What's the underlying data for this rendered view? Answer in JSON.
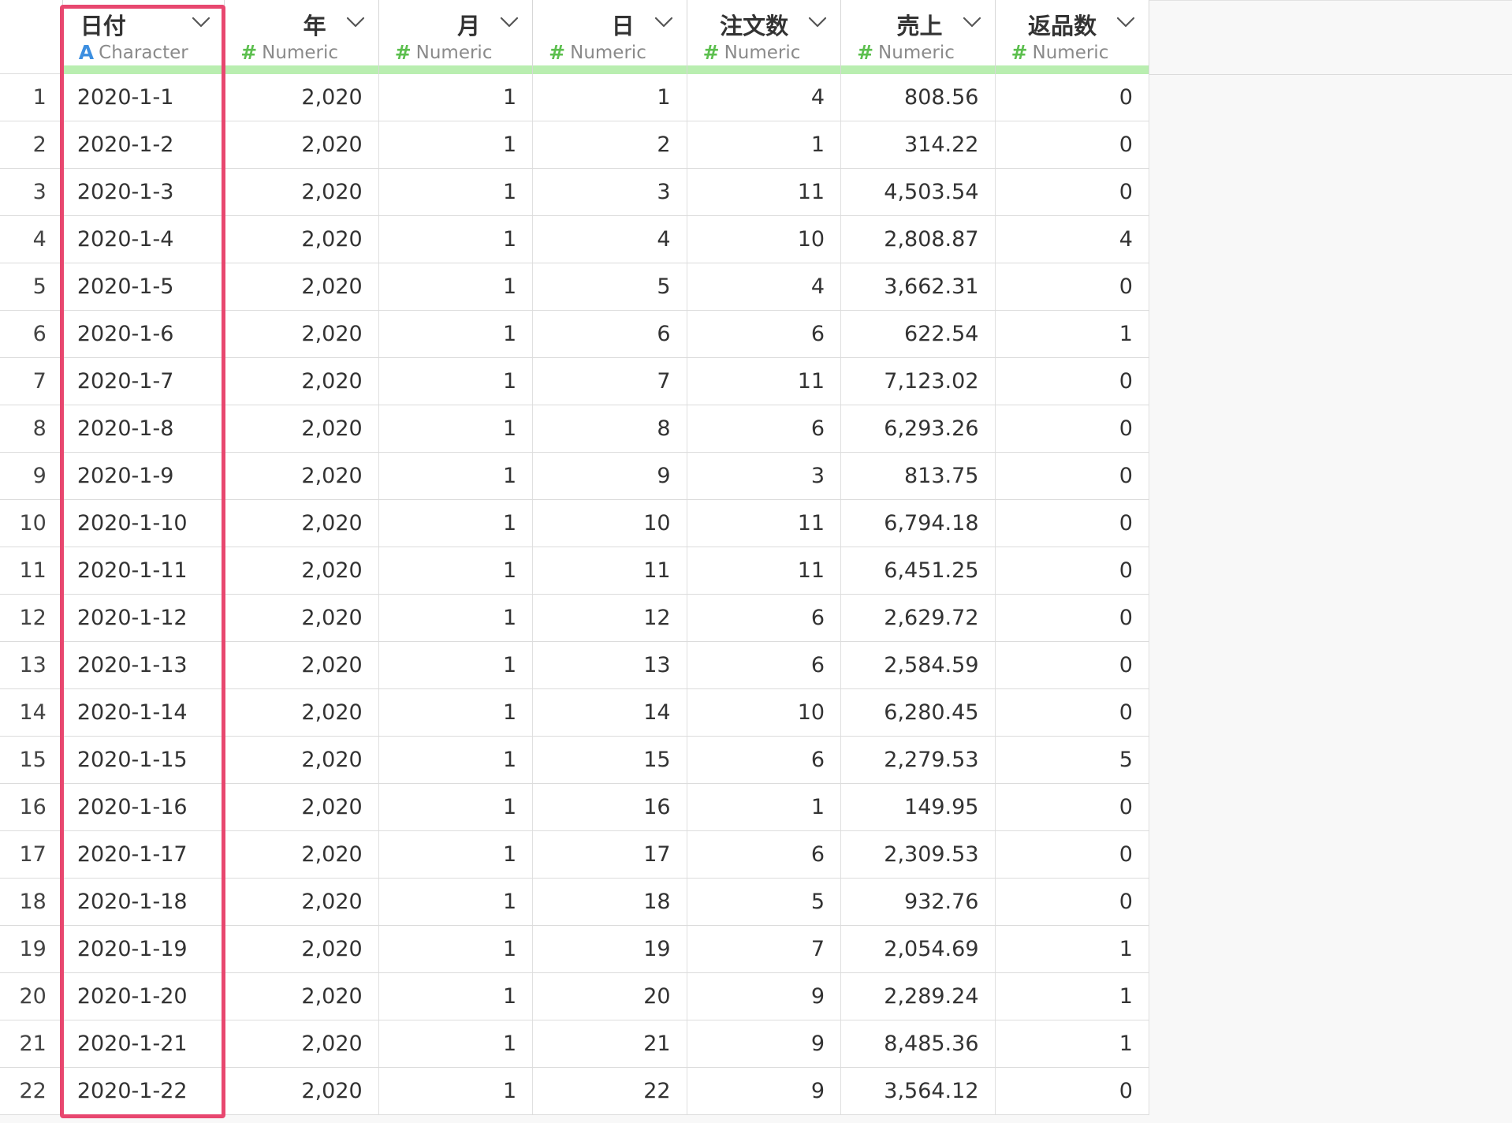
{
  "columns": [
    {
      "name": "日付",
      "type_icon": "A",
      "type_label": "Character",
      "kind": "character"
    },
    {
      "name": "年",
      "type_icon": "#",
      "type_label": "Numeric",
      "kind": "numeric"
    },
    {
      "name": "月",
      "type_icon": "#",
      "type_label": "Numeric",
      "kind": "numeric"
    },
    {
      "name": "日",
      "type_icon": "#",
      "type_label": "Numeric",
      "kind": "numeric"
    },
    {
      "name": "注文数",
      "type_icon": "#",
      "type_label": "Numeric",
      "kind": "numeric"
    },
    {
      "name": "売上",
      "type_icon": "#",
      "type_label": "Numeric",
      "kind": "numeric"
    },
    {
      "name": "返品数",
      "type_icon": "#",
      "type_label": "Numeric",
      "kind": "numeric"
    }
  ],
  "rows": [
    {
      "index": "1",
      "cells": [
        "2020-1-1",
        "2,020",
        "1",
        "1",
        "4",
        "808.56",
        "0"
      ]
    },
    {
      "index": "2",
      "cells": [
        "2020-1-2",
        "2,020",
        "1",
        "2",
        "1",
        "314.22",
        "0"
      ]
    },
    {
      "index": "3",
      "cells": [
        "2020-1-3",
        "2,020",
        "1",
        "3",
        "11",
        "4,503.54",
        "0"
      ]
    },
    {
      "index": "4",
      "cells": [
        "2020-1-4",
        "2,020",
        "1",
        "4",
        "10",
        "2,808.87",
        "4"
      ]
    },
    {
      "index": "5",
      "cells": [
        "2020-1-5",
        "2,020",
        "1",
        "5",
        "4",
        "3,662.31",
        "0"
      ]
    },
    {
      "index": "6",
      "cells": [
        "2020-1-6",
        "2,020",
        "1",
        "6",
        "6",
        "622.54",
        "1"
      ]
    },
    {
      "index": "7",
      "cells": [
        "2020-1-7",
        "2,020",
        "1",
        "7",
        "11",
        "7,123.02",
        "0"
      ]
    },
    {
      "index": "8",
      "cells": [
        "2020-1-8",
        "2,020",
        "1",
        "8",
        "6",
        "6,293.26",
        "0"
      ]
    },
    {
      "index": "9",
      "cells": [
        "2020-1-9",
        "2,020",
        "1",
        "9",
        "3",
        "813.75",
        "0"
      ]
    },
    {
      "index": "10",
      "cells": [
        "2020-1-10",
        "2,020",
        "1",
        "10",
        "11",
        "6,794.18",
        "0"
      ]
    },
    {
      "index": "11",
      "cells": [
        "2020-1-11",
        "2,020",
        "1",
        "11",
        "11",
        "6,451.25",
        "0"
      ]
    },
    {
      "index": "12",
      "cells": [
        "2020-1-12",
        "2,020",
        "1",
        "12",
        "6",
        "2,629.72",
        "0"
      ]
    },
    {
      "index": "13",
      "cells": [
        "2020-1-13",
        "2,020",
        "1",
        "13",
        "6",
        "2,584.59",
        "0"
      ]
    },
    {
      "index": "14",
      "cells": [
        "2020-1-14",
        "2,020",
        "1",
        "14",
        "10",
        "6,280.45",
        "0"
      ]
    },
    {
      "index": "15",
      "cells": [
        "2020-1-15",
        "2,020",
        "1",
        "15",
        "6",
        "2,279.53",
        "5"
      ]
    },
    {
      "index": "16",
      "cells": [
        "2020-1-16",
        "2,020",
        "1",
        "16",
        "1",
        "149.95",
        "0"
      ]
    },
    {
      "index": "17",
      "cells": [
        "2020-1-17",
        "2,020",
        "1",
        "17",
        "6",
        "2,309.53",
        "0"
      ]
    },
    {
      "index": "18",
      "cells": [
        "2020-1-18",
        "2,020",
        "1",
        "18",
        "5",
        "932.76",
        "0"
      ]
    },
    {
      "index": "19",
      "cells": [
        "2020-1-19",
        "2,020",
        "1",
        "19",
        "7",
        "2,054.69",
        "1"
      ]
    },
    {
      "index": "20",
      "cells": [
        "2020-1-20",
        "2,020",
        "1",
        "20",
        "9",
        "2,289.24",
        "1"
      ]
    },
    {
      "index": "21",
      "cells": [
        "2020-1-21",
        "2,020",
        "1",
        "21",
        "9",
        "8,485.36",
        "1"
      ]
    },
    {
      "index": "22",
      "cells": [
        "2020-1-22",
        "2,020",
        "1",
        "22",
        "9",
        "3,564.12",
        "0"
      ]
    }
  ],
  "colors": {
    "type_bar": "#b9eeb0",
    "character_icon": "#3d8fe0",
    "numeric_icon": "#5cbf4e",
    "selection_outline": "#e8476f"
  },
  "icons": {
    "column_menu": "chevron-down-icon",
    "character_type": "character-type-icon",
    "numeric_type": "numeric-type-icon"
  }
}
